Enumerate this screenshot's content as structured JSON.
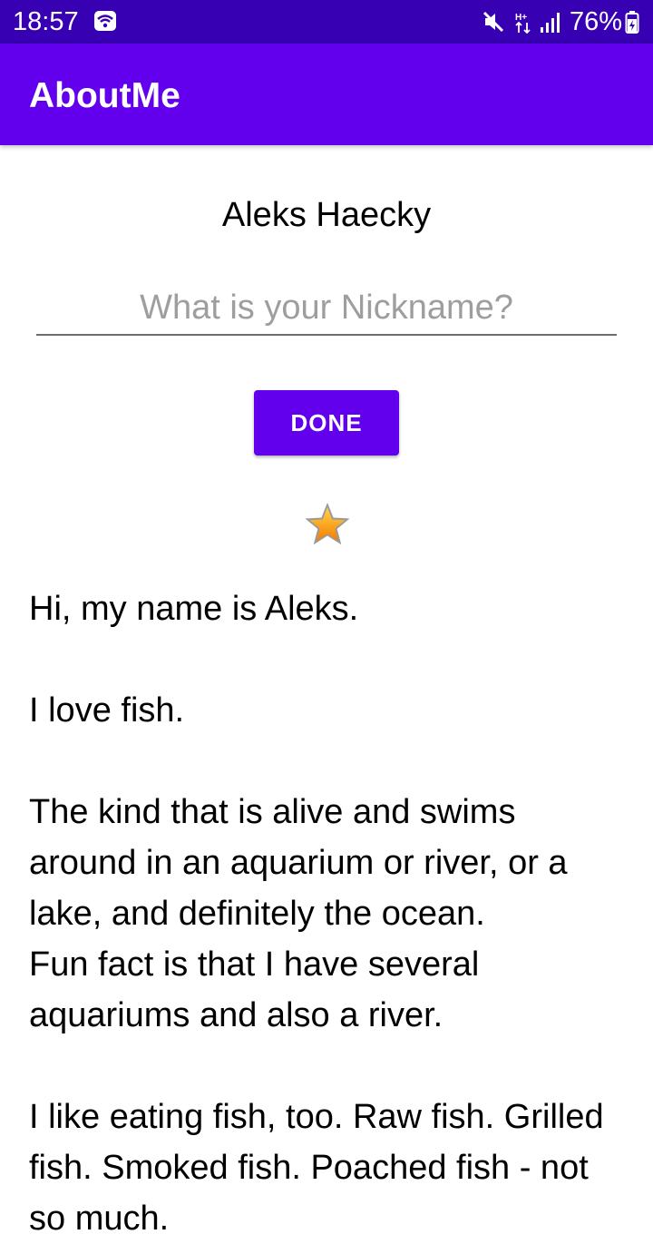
{
  "status_bar": {
    "time": "18:57",
    "battery_percent": "76%",
    "icons": [
      "wifi-icon",
      "mute-icon",
      "data-icon",
      "signal-icon",
      "battery-icon"
    ],
    "background_color": "#3700b3"
  },
  "app_bar": {
    "title": "AboutMe",
    "background_color": "#6200ee"
  },
  "profile": {
    "name": "Aleks Haecky",
    "nickname_value": "",
    "nickname_placeholder": "What is your Nickname?",
    "done_label": "DONE",
    "star_icon": "star-icon"
  },
  "bio": {
    "text": "Hi, my name is Aleks.\n\nI love fish.\n\nThe kind that is alive and swims around in an aquarium or river, or a lake, and definitely the ocean.\nFun fact is that I have several aquariums and also a river.\n\nI like eating fish, too. Raw fish. Grilled fish. Smoked fish. Poached fish - not so much."
  }
}
